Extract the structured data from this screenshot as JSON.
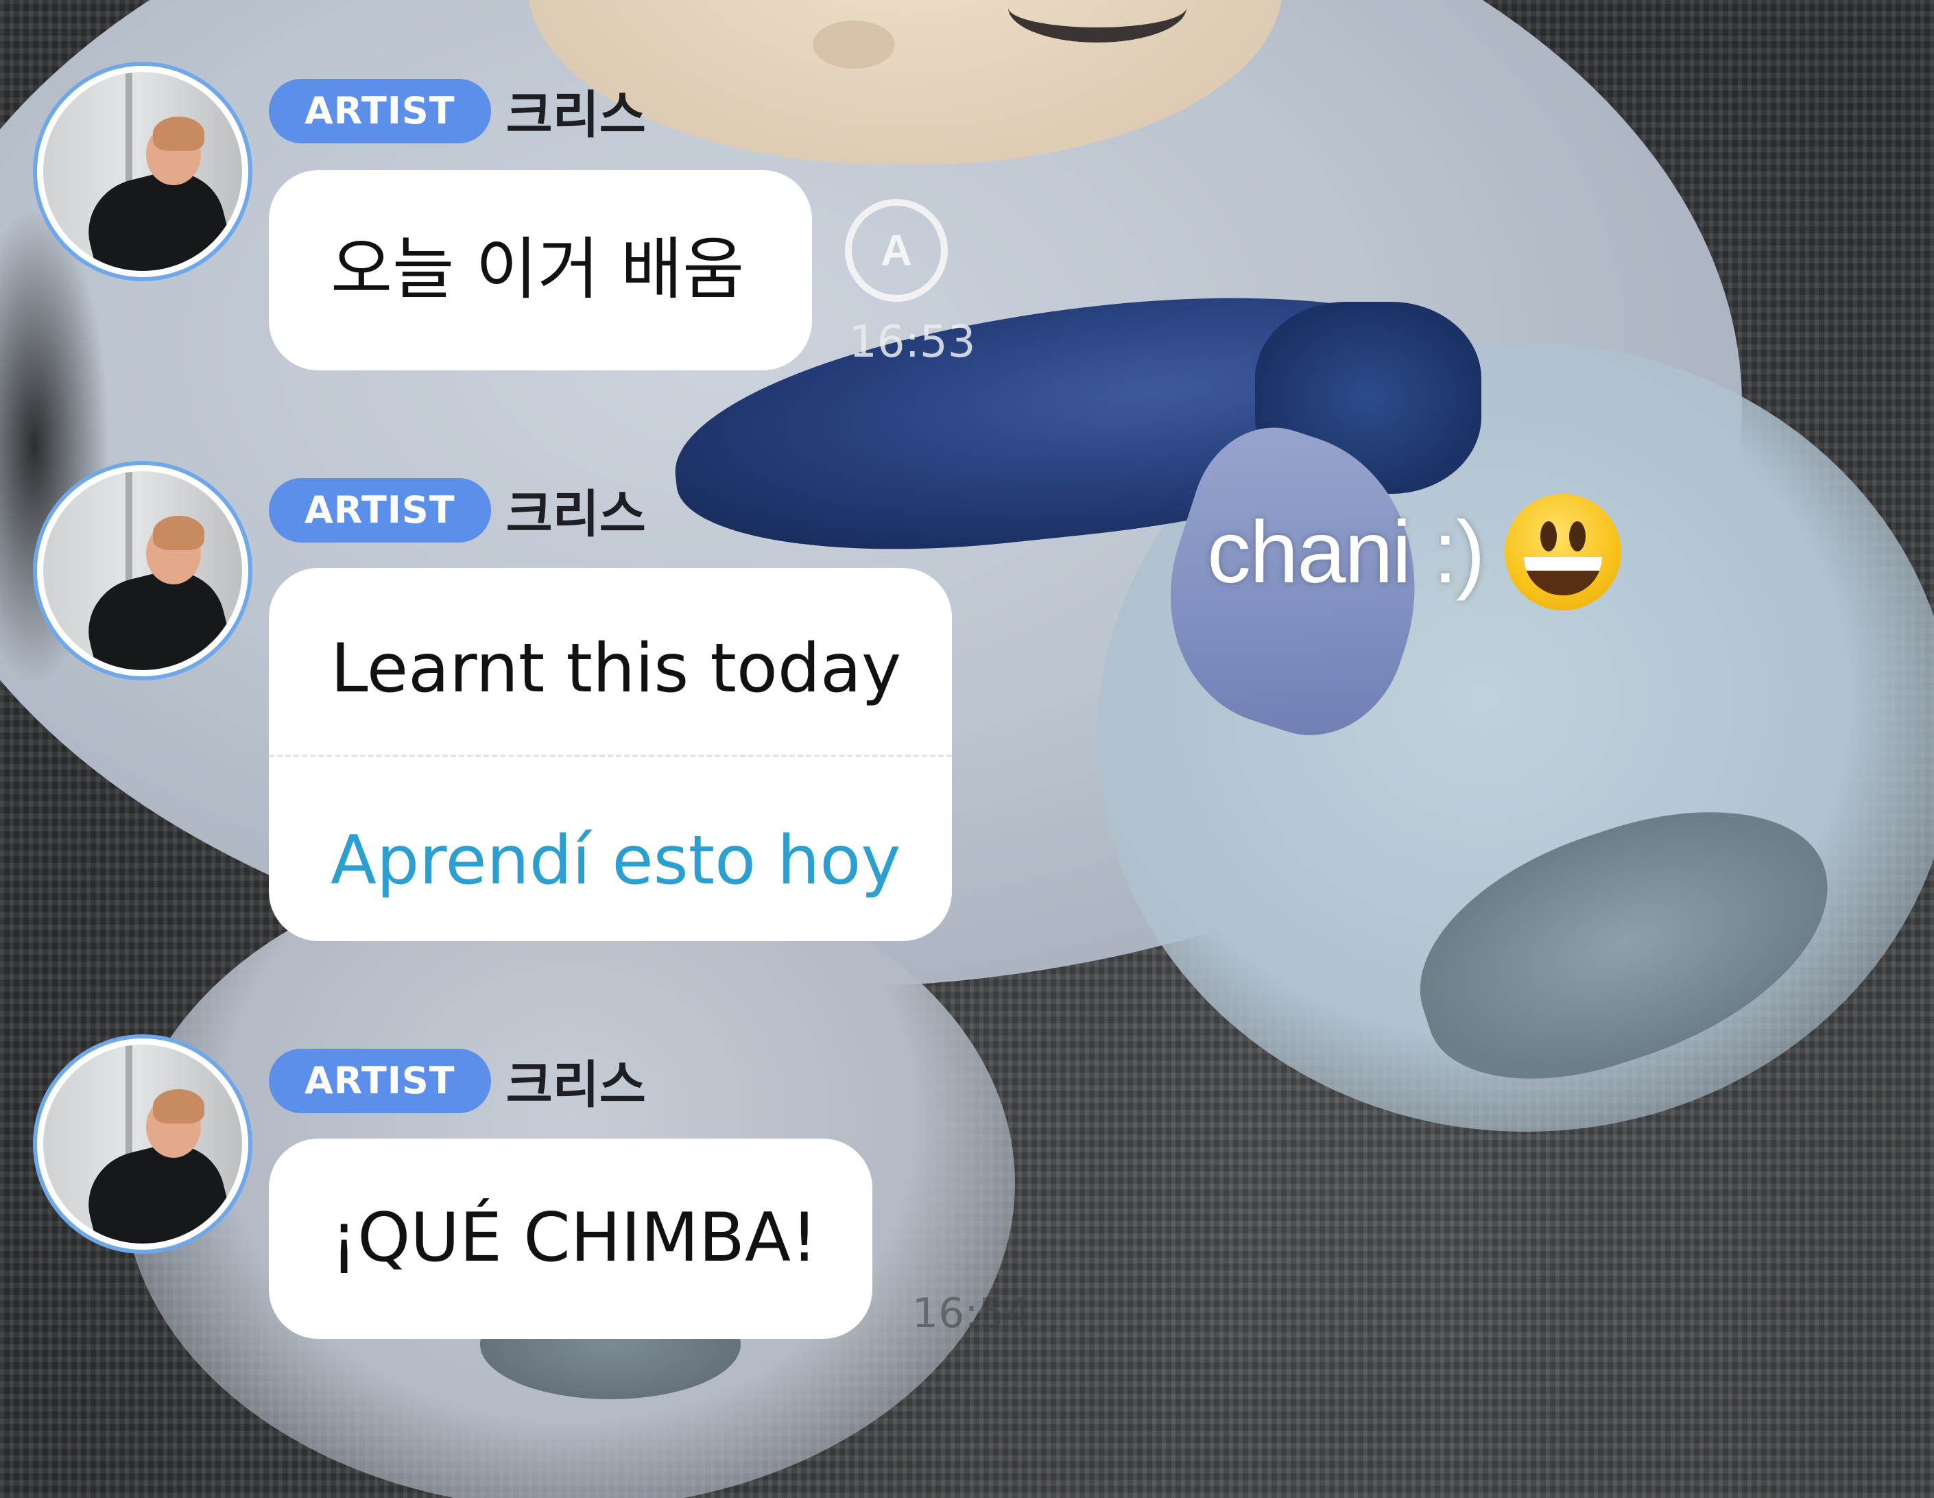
{
  "messages": [
    {
      "badge": "ARTIST",
      "sender": "크리스",
      "text": "오늘 이거 배움",
      "time": "16:53"
    },
    {
      "badge": "ARTIST",
      "sender": "크리스",
      "text": "Learnt this today",
      "translation": "Aprendí esto hoy"
    },
    {
      "badge": "ARTIST",
      "sender": "크리스",
      "text": "¡QUÉ CHIMBA!",
      "time": "16:54"
    }
  ],
  "translate_icon_glyph": "A",
  "caption": {
    "text": "chani :)",
    "emoji": "grinning-face"
  },
  "colors": {
    "badge": "#5b8fea",
    "avatar_ring": "#6ea8ea",
    "translation_text": "#2c9fd1",
    "bubble": "#ffffff"
  }
}
